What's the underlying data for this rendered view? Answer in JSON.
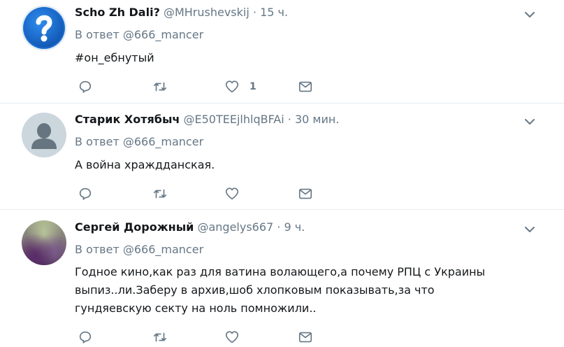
{
  "tweets": [
    {
      "name": "Scho Zh Dali?",
      "handle": "@MHrushevskij",
      "dot": "·",
      "time": "15 ч.",
      "reply_prefix": "В ответ",
      "reply_to": "@666_mancer",
      "text": "#он_ебнутый",
      "like_count": "1",
      "avatar": "question-mark-avatar"
    },
    {
      "name": "Старик Хотябыч",
      "handle": "@E50TEEjlhlqBFAi",
      "dot": "·",
      "time": "30 мин.",
      "reply_prefix": "В ответ",
      "reply_to": "@666_mancer",
      "text": "А война храждданская.",
      "like_count": "",
      "avatar": "default-profile-avatar"
    },
    {
      "name": "Сергей Дорожный",
      "handle": "@angelys667",
      "dot": "·",
      "time": "9 ч.",
      "reply_prefix": "В ответ",
      "reply_to": "@666_mancer",
      "text": "Годное кино,как раз для ватина волающего,а почему РПЦ с Украины выпиз..ли.Заберу в архив,шоб хлопковым показывать,за что гундяевскую секту на ноль помножили..",
      "like_count": "",
      "avatar": "photo-avatar"
    }
  ],
  "icons": {
    "reply": "reply-icon",
    "retweet": "retweet-icon",
    "like": "heart-icon",
    "dm": "envelope-icon",
    "menu": "chevron-down-icon"
  },
  "colors": {
    "text": "#14171a",
    "muted": "#657786",
    "separator": "#e6ecf0"
  }
}
